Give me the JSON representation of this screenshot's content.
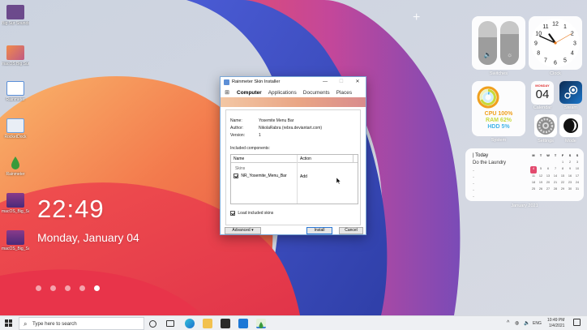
{
  "desktop": {
    "icons": [
      {
        "label": "Big Sur Sounds",
        "color": "#6c4a8c"
      },
      {
        "label": "macOS Big Sur",
        "color": "#c05a84"
      },
      {
        "label": "Rainmeter",
        "color": "#5a8fd8"
      },
      {
        "label": "RocketDock",
        "color": "#6ba0e0"
      },
      {
        "label": "Rainmeter",
        "color": "#3a9a3a"
      },
      {
        "label": "macOS_Big_Sur",
        "color": "#6c4a8c"
      },
      {
        "label": "macOS_Big_Sur",
        "color": "#6c4a8c"
      }
    ],
    "plus_mark": "+",
    "time": "22:49",
    "date": "Monday, January 04",
    "page_dots": 5,
    "active_page": 5
  },
  "widgets": {
    "switches": {
      "label": "Switches",
      "sound_glyph": "🔈",
      "brightness_glyph": "☼"
    },
    "clock": {
      "label": "Clock",
      "numerals": [
        "12",
        "1",
        "2",
        "3",
        "4",
        "5",
        "6",
        "7",
        "8",
        "9",
        "10",
        "11"
      ],
      "hour": 10,
      "minute": 49,
      "second": 10
    },
    "system": {
      "label": "System",
      "cpu": "CPU 100%",
      "ram": "RAM 62%",
      "hdd": "HDD 5%",
      "cpu_color": "#f0a01e",
      "ram_color": "#c8d93a",
      "hdd_color": "#43b4e8"
    },
    "calendar": {
      "label": "Calendar",
      "day_name": "MONDAY",
      "day_num": "04"
    },
    "steam": {
      "label": "Steam"
    },
    "settings": {
      "label": "Settings"
    },
    "mode": {
      "label": "Mode"
    },
    "agenda": {
      "title": "| Today",
      "item": "Do the Laundry",
      "dashes": [
        "-",
        "-",
        "-",
        "-",
        "-"
      ],
      "caption": "January 2021",
      "weekdays": [
        "M",
        "T",
        "W",
        "T",
        "F",
        "S",
        "S"
      ],
      "weeks": [
        [
          "",
          "",
          "",
          "",
          "1",
          "2",
          "3"
        ],
        [
          "4",
          "5",
          "6",
          "7",
          "8",
          "9",
          "10"
        ],
        [
          "11",
          "12",
          "13",
          "14",
          "15",
          "16",
          "17"
        ],
        [
          "18",
          "19",
          "20",
          "21",
          "22",
          "23",
          "24"
        ],
        [
          "25",
          "26",
          "27",
          "28",
          "29",
          "30",
          "31"
        ],
        [
          "",
          "",
          "",
          "",
          "",
          "",
          ""
        ]
      ],
      "today": "4"
    }
  },
  "installer": {
    "title": "Rainmeter Skin Installer",
    "minimize": "—",
    "maximize": "☐",
    "close": "✕",
    "tabs": [
      "Computer",
      "Applications",
      "Documents",
      "Places"
    ],
    "active_tab": "Computer",
    "name_key": "Name:",
    "name_val": "Yosemite Menu Bar",
    "author_key": "Author:",
    "author_val": "NikolaRabra (rebra.deviantart.com)",
    "version_key": "Version:",
    "version_val": "1",
    "included_label": "Included components:",
    "col_name": "Name",
    "col_action": "Action",
    "group": "Skins",
    "skin_name": "NR_Yosemite_Menu_Bar",
    "skin_action": "Add",
    "load_label": "Load included skins",
    "advanced": "Advanced",
    "install": "Install",
    "cancel": "Cancel"
  },
  "taskbar": {
    "search_placeholder": "Type here to search",
    "tray_lang": "ENG",
    "tray_time": "10:49 PM",
    "tray_date": "1/4/2021"
  }
}
